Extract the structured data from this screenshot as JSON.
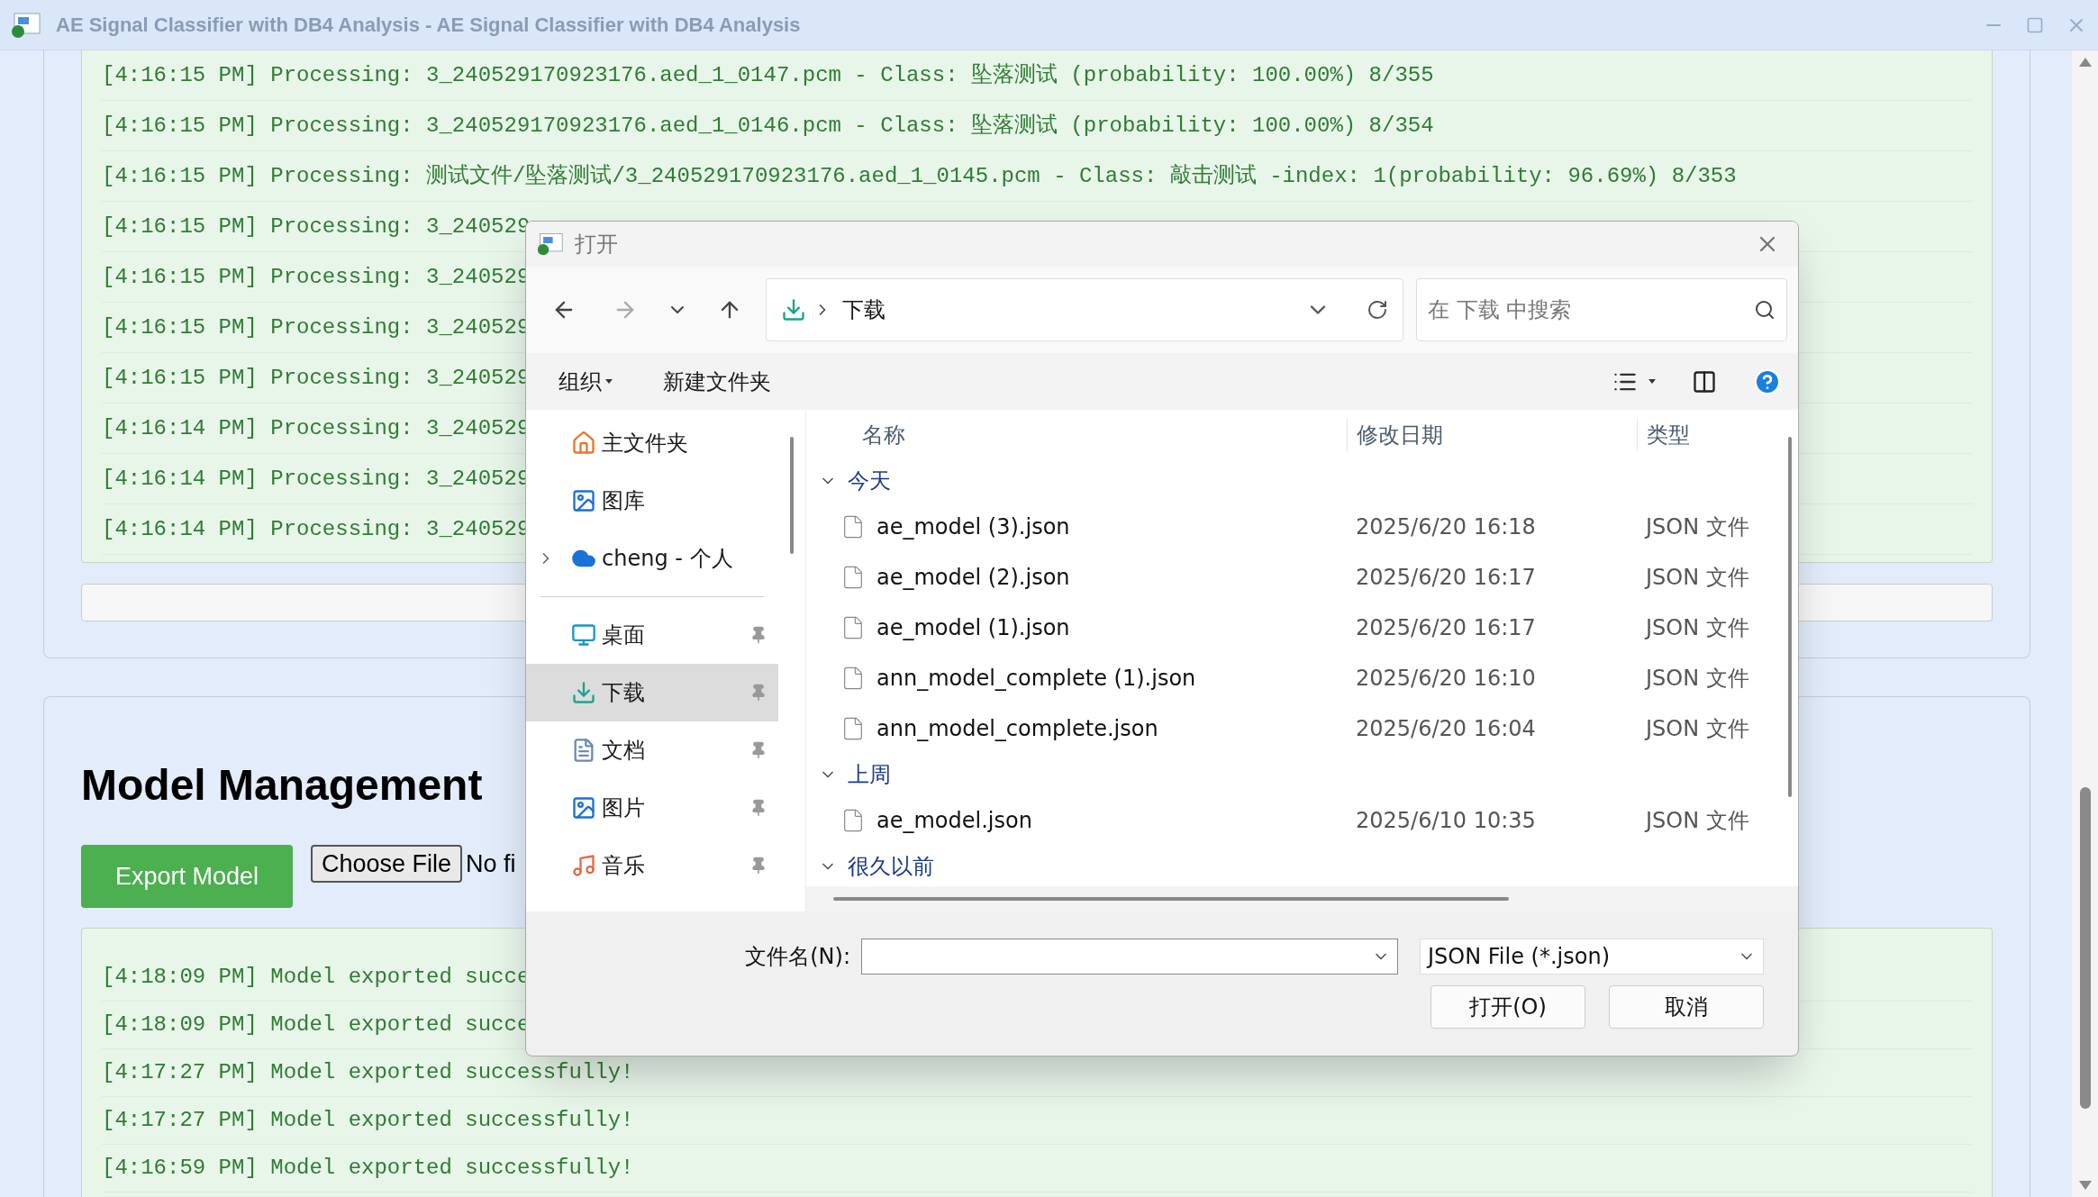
{
  "window": {
    "title": "AE Signal Classifier with DB4 Analysis - AE Signal Classifier with DB4 Analysis"
  },
  "classification_log": {
    "lines": [
      "[4:16:15 PM] Processing: 3_240529170923176.aed_1_0147.pcm - Class: 坠落测试 (probability: 100.00%) 8/355",
      "[4:16:15 PM] Processing: 3_240529170923176.aed_1_0146.pcm - Class: 坠落测试 (probability: 100.00%) 8/354",
      "[4:16:15 PM] Processing: 测试文件/坠落测试/3_240529170923176.aed_1_0145.pcm - Class: 敲击测试 -index: 1(probability: 96.69%) 8/353",
      "[4:16:15 PM] Processing: 3_240529",
      "[4:16:15 PM] Processing: 3_240529",
      "[4:16:15 PM] Processing: 3_240529",
      "[4:16:15 PM] Processing: 3_240529",
      "[4:16:14 PM] Processing: 3_240529",
      "[4:16:14 PM] Processing: 3_240529",
      "[4:16:14 PM] Processing: 3_240529"
    ],
    "progress": {
      "level": 0
    }
  },
  "model_management": {
    "heading": "Model Management",
    "export_button": "Export Model",
    "choose_file_button": "Choose File",
    "file_status": "No fi",
    "log": [
      "[4:18:09 PM] Model exported succe",
      "[4:18:09 PM] Model exported succe",
      "[4:17:27 PM] Model exported successfully!",
      "[4:17:27 PM] Model exported successfully!",
      "[4:16:59 PM] Model exported successfully!"
    ]
  },
  "dialog": {
    "title": "打开",
    "breadcrumb": "下载",
    "search_placeholder": "在 下载 中搜索",
    "organize": "组织",
    "new_folder": "新建文件夹",
    "nav_items": [
      {
        "label": "主文件夹",
        "kind": "home",
        "selected": false,
        "pinned": false,
        "expandable": false
      },
      {
        "label": "图库",
        "kind": "gallery",
        "selected": false,
        "pinned": false,
        "expandable": false
      },
      {
        "label": "cheng - 个人",
        "kind": "cloud",
        "selected": false,
        "pinned": false,
        "expandable": true
      }
    ],
    "quick_access": [
      {
        "label": "桌面",
        "kind": "desktop",
        "selected": false,
        "pinned": true,
        "expandable": false
      },
      {
        "label": "下载",
        "kind": "downloads",
        "selected": true,
        "pinned": true,
        "expandable": false
      },
      {
        "label": "文档",
        "kind": "documents",
        "selected": false,
        "pinned": true,
        "expandable": false
      },
      {
        "label": "图片",
        "kind": "pictures",
        "selected": false,
        "pinned": true,
        "expandable": false
      },
      {
        "label": "音乐",
        "kind": "music",
        "selected": false,
        "pinned": true,
        "expandable": false
      }
    ],
    "columns": [
      "名称",
      "修改日期",
      "类型"
    ],
    "groups": [
      {
        "label": "今天",
        "expanded": true,
        "files": [
          {
            "name": "ae_model (3).json",
            "date": "2025/6/20 16:18",
            "type": "JSON 文件"
          },
          {
            "name": "ae_model (2).json",
            "date": "2025/6/20 16:17",
            "type": "JSON 文件"
          },
          {
            "name": "ae_model (1).json",
            "date": "2025/6/20 16:17",
            "type": "JSON 文件"
          },
          {
            "name": "ann_model_complete (1).json",
            "date": "2025/6/20 16:10",
            "type": "JSON 文件"
          },
          {
            "name": "ann_model_complete.json",
            "date": "2025/6/20 16:04",
            "type": "JSON 文件"
          }
        ]
      },
      {
        "label": "上周",
        "expanded": true,
        "files": [
          {
            "name": "ae_model.json",
            "date": "2025/6/10 10:35",
            "type": "JSON 文件"
          }
        ]
      },
      {
        "label": "很久以前",
        "expanded": true
      }
    ],
    "filename_label": "文件名(N):",
    "filetype": "JSON File (*.json)",
    "open_button": "打开(O)",
    "cancel_button": "取消"
  }
}
